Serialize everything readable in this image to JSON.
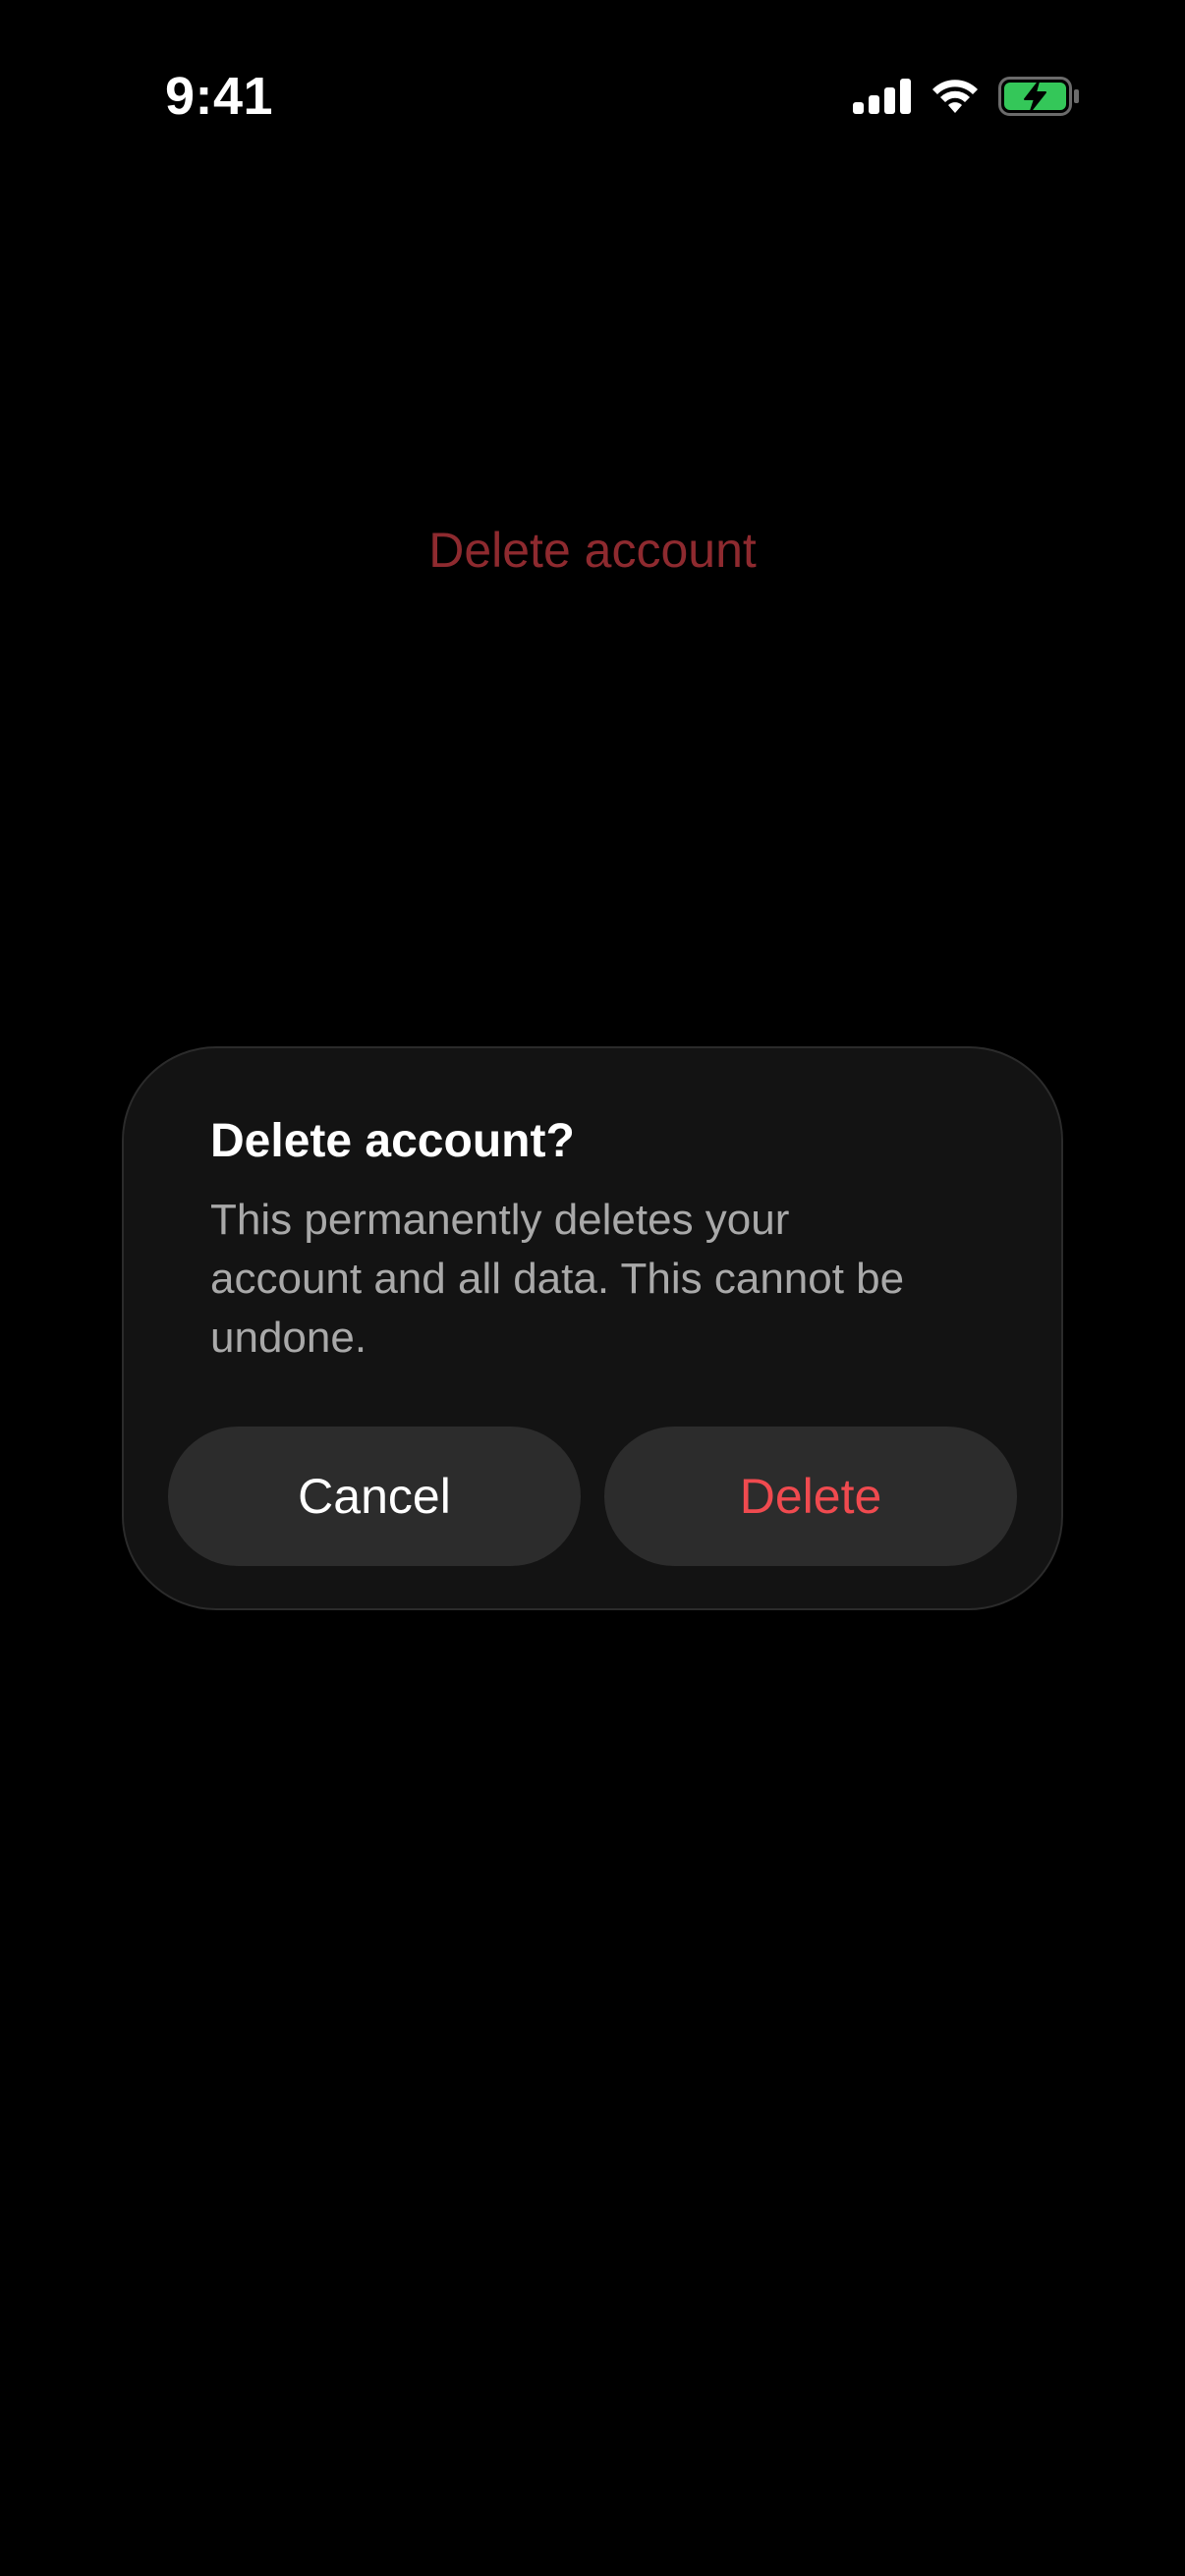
{
  "status_bar": {
    "time": "9:41",
    "icons": [
      "cellular-signal-icon",
      "wifi-icon",
      "battery-charging-icon"
    ],
    "battery_color": "#34c759"
  },
  "background": {
    "action_label": "Delete account",
    "action_color": "#8e2a2f"
  },
  "dialog": {
    "title": "Delete account?",
    "message_lines": [
      "This permanently deletes your",
      "account and all data. This cannot be",
      "undone."
    ],
    "cancel_label": "Cancel",
    "delete_label": "Delete",
    "delete_color": "#f04a4f"
  }
}
